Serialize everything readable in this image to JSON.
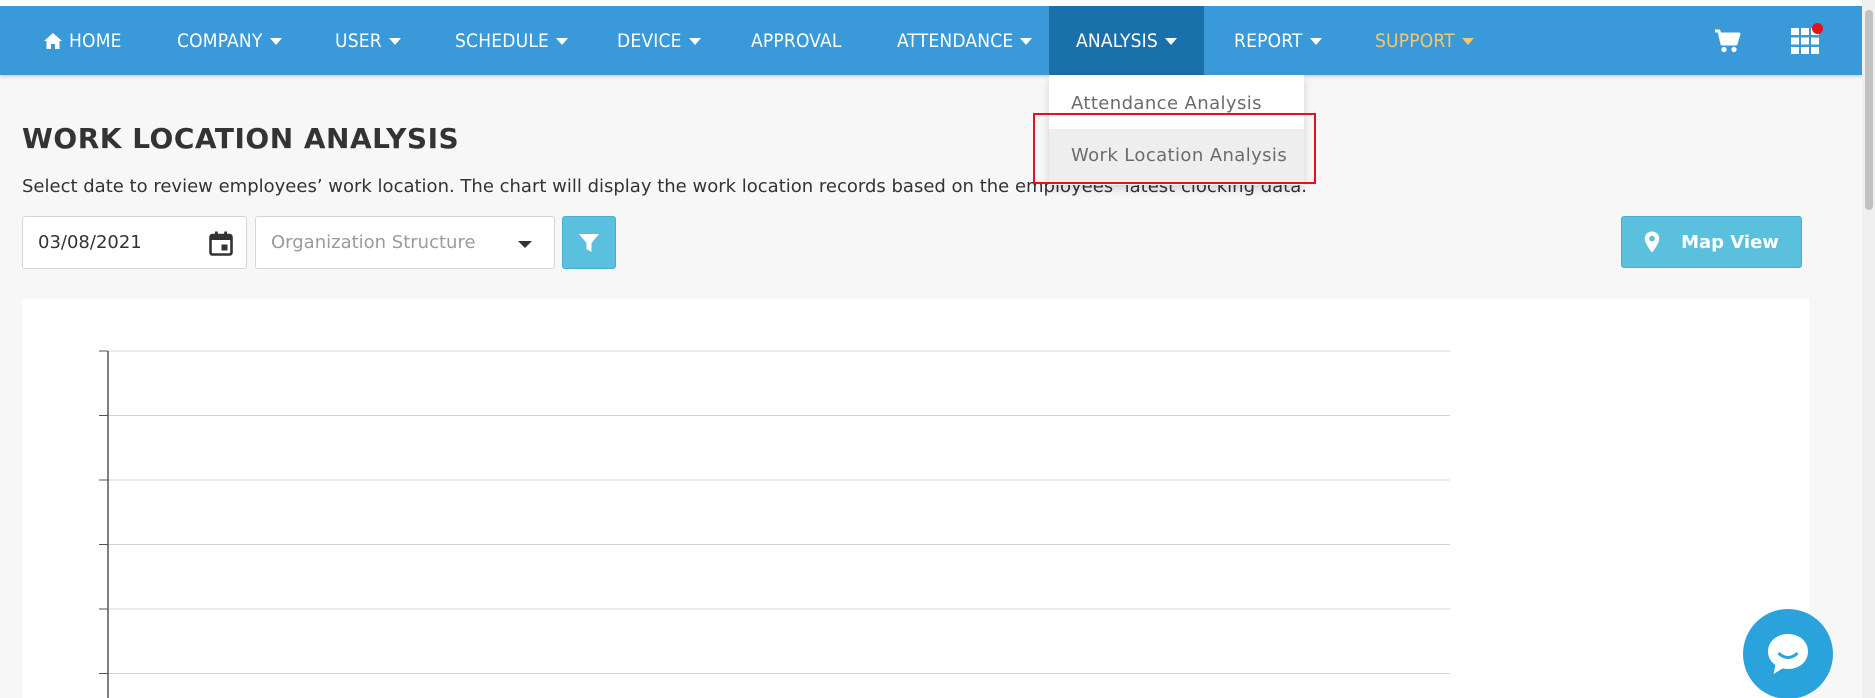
{
  "nav": {
    "items": [
      {
        "label": "HOME",
        "has_caret": false
      },
      {
        "label": "COMPANY",
        "has_caret": true
      },
      {
        "label": "USER",
        "has_caret": true
      },
      {
        "label": "SCHEDULE",
        "has_caret": true
      },
      {
        "label": "DEVICE",
        "has_caret": true
      },
      {
        "label": "APPROVAL",
        "has_caret": false
      },
      {
        "label": "ATTENDANCE",
        "has_caret": true
      },
      {
        "label": "ANALYSIS",
        "has_caret": true,
        "active": true
      },
      {
        "label": "REPORT",
        "has_caret": true
      },
      {
        "label": "SUPPORT",
        "has_caret": true
      }
    ],
    "icons": [
      "home-icon",
      "cart-icon",
      "apps-grid-icon"
    ],
    "colors": {
      "bar": "#3a9ad9",
      "active": "#1a70aa",
      "support": "#f7c56a",
      "notification": "#e3121b"
    }
  },
  "dropdown": {
    "items": [
      {
        "label": "Attendance Analysis"
      },
      {
        "label": "Work Location Analysis",
        "highlighted": true
      }
    ]
  },
  "page": {
    "title": "WORK LOCATION ANALYSIS",
    "description": "Select date to review employees’ work location. The chart will display the work location records based on the employees’ latest clocking data."
  },
  "filters": {
    "date_value": "03/08/2021",
    "org_placeholder": "Organization Structure",
    "map_view_label": "Map View"
  },
  "chart_data": {
    "type": "bar",
    "categories": [],
    "values": [],
    "grid": true
  }
}
